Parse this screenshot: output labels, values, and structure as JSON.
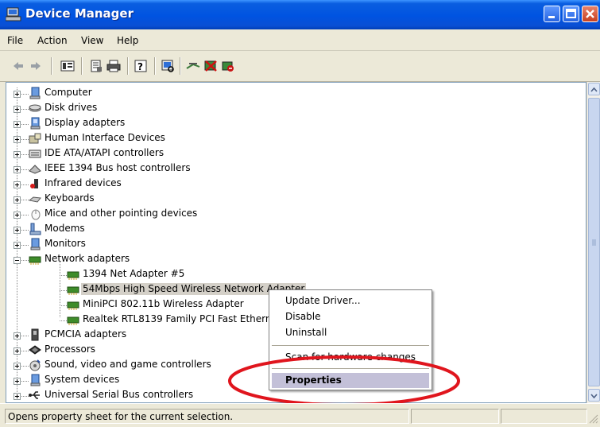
{
  "window": {
    "title": "Device Manager"
  },
  "menu": [
    "File",
    "Action",
    "View",
    "Help"
  ],
  "toolbar": {
    "icons": [
      "back-icon",
      "forward-icon",
      "view-icon",
      "properties-icon",
      "print-icon",
      "help-icon",
      "scan-hardware-icon",
      "update-driver-icon",
      "uninstall-icon",
      "disable-icon"
    ]
  },
  "tree": {
    "categories": [
      "Computer",
      "Disk drives",
      "Display adapters",
      "Human Interface Devices",
      "IDE ATA/ATAPI controllers",
      "IEEE 1394 Bus host controllers",
      "Infrared devices",
      "Keyboards",
      "Mice and other pointing devices",
      "Modems",
      "Monitors",
      "Network adapters",
      "PCMCIA adapters",
      "Processors",
      "Sound, video and game controllers",
      "System devices",
      "Universal Serial Bus controllers"
    ],
    "network_children": [
      "1394 Net Adapter #5",
      "54Mbps High Speed Wireless Network Adapter",
      "MiniPCI 802.11b Wireless Adapter",
      "Realtek RTL8139 Family PCI Fast Ethernet"
    ],
    "selected": "54Mbps High Speed Wireless Network Adapter"
  },
  "context_menu": {
    "items": [
      "Update Driver...",
      "Disable",
      "Uninstall",
      "Scan for hardware changes",
      "Properties"
    ],
    "highlighted": "Properties"
  },
  "status": {
    "text": "Opens property sheet for the current selection."
  },
  "colors": {
    "titlebar": "#0053e1",
    "highlight_ring": "#e0151d",
    "selection": "#d4d0c8",
    "menu_hover": "#c3c0d8"
  }
}
